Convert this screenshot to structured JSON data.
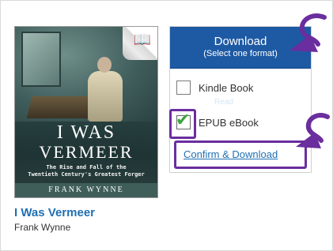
{
  "book": {
    "cover_title_line1": "I WAS",
    "cover_title_line2": "VERMEER",
    "cover_subtitle_line1": "The Rise and Fall of the",
    "cover_subtitle_line2": "Twentieth Century's Greatest Forger",
    "cover_author": "FRANK WYNNE",
    "title": "I Was Vermeer",
    "author": "Frank Wynne",
    "icon": "open-book-icon"
  },
  "download_panel": {
    "header_title": "Download",
    "header_subtitle": "(Select one format)",
    "options": [
      {
        "label": "Kindle Book",
        "checked": false
      },
      {
        "label": "EPUB eBook",
        "checked": true
      }
    ],
    "ghost_text": "Read",
    "confirm_label": "Confirm & Download"
  },
  "colors": {
    "header_blue": "#1e5aa4",
    "link_blue": "#1f6fb3",
    "highlight_purple": "#6a2e9e",
    "check_green": "#3ba33b"
  }
}
